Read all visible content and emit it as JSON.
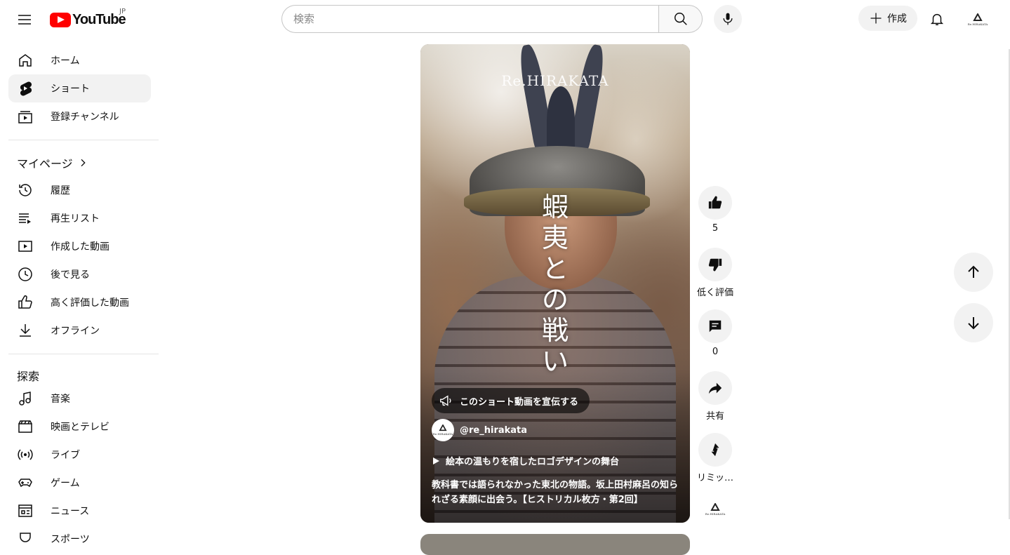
{
  "header": {
    "logo_text": "YouTube",
    "region": "JP",
    "search_placeholder": "検索",
    "create_label": "作成"
  },
  "sidebar": {
    "primary": [
      {
        "label": "ホーム",
        "icon": "home-icon"
      },
      {
        "label": "ショート",
        "icon": "shorts-icon",
        "active": true
      },
      {
        "label": "登録チャンネル",
        "icon": "subscriptions-icon"
      }
    ],
    "mypage_title": "マイページ",
    "mypage": [
      {
        "label": "履歴",
        "icon": "history-icon"
      },
      {
        "label": "再生リスト",
        "icon": "playlist-icon"
      },
      {
        "label": "作成した動画",
        "icon": "your-videos-icon"
      },
      {
        "label": "後で見る",
        "icon": "watch-later-icon"
      },
      {
        "label": "高く評価した動画",
        "icon": "liked-icon"
      },
      {
        "label": "オフライン",
        "icon": "download-icon"
      }
    ],
    "explore_title": "探索",
    "explore": [
      {
        "label": "音楽",
        "icon": "music-icon"
      },
      {
        "label": "映画とテレビ",
        "icon": "movies-icon"
      },
      {
        "label": "ライブ",
        "icon": "live-icon"
      },
      {
        "label": "ゲーム",
        "icon": "gaming-icon"
      },
      {
        "label": "ニュース",
        "icon": "news-icon"
      },
      {
        "label": "スポーツ",
        "icon": "sports-icon"
      }
    ]
  },
  "short": {
    "watermark": "Re.HIRAKATA",
    "title_overlay": "蝦夷との戦い",
    "promote_label": "このショート動画を宣伝する",
    "channel_handle": "@re_hirakata",
    "channel_avatar_text": "Re.HIRAKATA",
    "link_text": "絵本の温もりを宿したロゴデザインの舞台",
    "description": "教科書では語られなかった東北の物語。坂上田村麻呂の知られざる素顔に出会う。【ヒストリカル枚方・第2回】"
  },
  "actions": {
    "like_count": "5",
    "dislike_label": "低く評価",
    "comment_count": "0",
    "share_label": "共有",
    "remix_label": "リミッ…"
  },
  "colors": {
    "brand_red": "#ff0000",
    "button_bg": "#f2f2f2",
    "text": "#0f0f0f"
  }
}
